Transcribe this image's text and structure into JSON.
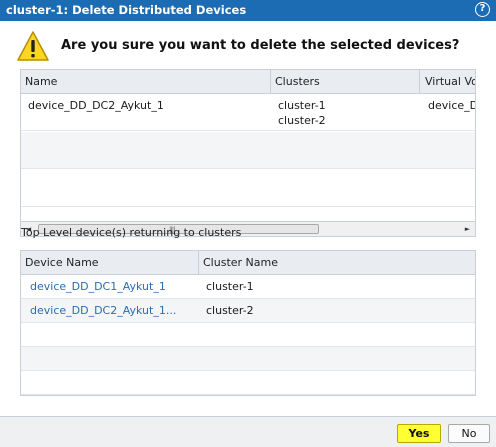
{
  "dialog": {
    "title": "cluster-1: Delete Distributed Devices",
    "help_icon": "question-icon",
    "help_symbol": "?"
  },
  "prompt": {
    "icon": "warning-icon",
    "question": "Are you sure you want to delete the selected devices?"
  },
  "devices_table": {
    "columns": [
      "Name",
      "Clusters",
      "Virtual Vo"
    ],
    "rows": [
      {
        "name": "device_DD_DC2_Aykut_1",
        "clusters": [
          "cluster-1",
          "cluster-2"
        ],
        "virtual_volume": "device_D"
      }
    ]
  },
  "scrollbar": {
    "left_arrow": "◄",
    "right_arrow": "►",
    "grip": "||||"
  },
  "section": {
    "label": "Top Level device(s) returning to clusters"
  },
  "returning_table": {
    "columns": [
      "Device Name",
      "Cluster Name"
    ],
    "rows": [
      {
        "device_name": "device_DD_DC1_Aykut_1",
        "cluster_name": "cluster-1"
      },
      {
        "device_name": "device_DD_DC2_Aykut_1...",
        "cluster_name": "cluster-2"
      }
    ]
  },
  "buttons": {
    "yes": "Yes",
    "no": "No"
  },
  "colors": {
    "titlebar": "#1c6cb4",
    "yes_button": "#ffff33",
    "link": "#2b6cb0"
  }
}
